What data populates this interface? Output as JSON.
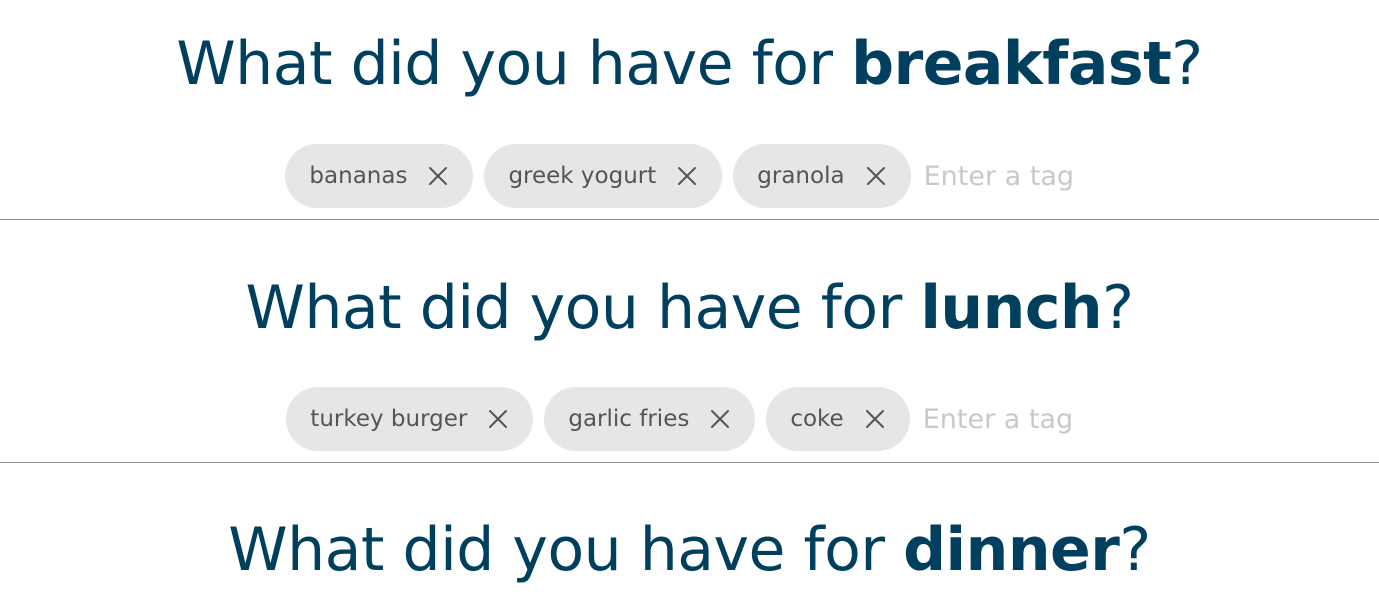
{
  "sections": [
    {
      "id": "breakfast",
      "question_prefix": "What did you have for ",
      "meal": "breakfast",
      "question_suffix": "?",
      "tags": [
        "bananas",
        "greek yogurt",
        "granola"
      ],
      "input_placeholder": "Enter a tag"
    },
    {
      "id": "lunch",
      "question_prefix": "What did you have for ",
      "meal": "lunch",
      "question_suffix": "?",
      "tags": [
        "turkey burger",
        "garlic fries",
        "coke"
      ],
      "input_placeholder": "Enter a tag"
    },
    {
      "id": "dinner",
      "question_prefix": "What did you have for ",
      "meal": "dinner",
      "question_suffix": "?"
    }
  ],
  "icons": {
    "tag_remove": "close-icon"
  },
  "colors": {
    "heading": "#00405e",
    "tag_background": "#e6e6e6",
    "tag_text": "#555555",
    "placeholder": "#c9c9c9",
    "divider": "#8a8a8a"
  }
}
